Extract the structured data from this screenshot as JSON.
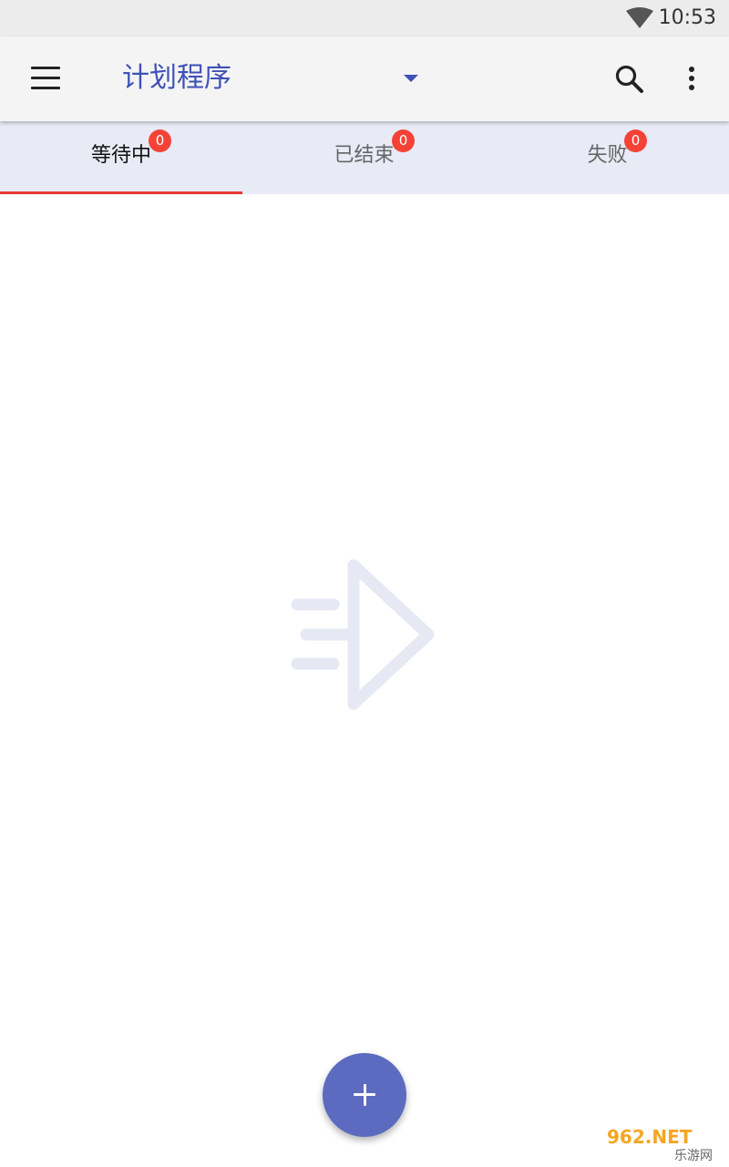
{
  "status_bar": {
    "time": "10:53",
    "icons": [
      "wifi-icon"
    ]
  },
  "app_bar": {
    "title": "计划程序",
    "icons": [
      "menu-icon",
      "dropdown-arrow-icon",
      "search-icon",
      "more-vert-icon"
    ]
  },
  "tabs": [
    {
      "label": "等待中",
      "badge": "0",
      "active": true
    },
    {
      "label": "已结束",
      "badge": "0",
      "active": false
    },
    {
      "label": "失败",
      "badge": "0",
      "active": false
    }
  ],
  "empty_state": {
    "icon": "send-arrow-icon"
  },
  "fab": {
    "icon": "plus-icon"
  },
  "watermark": {
    "text_top": "962.NET",
    "text_bottom": "乐游网"
  },
  "colors": {
    "primary": "#3f51b5",
    "fab": "#5c6bc0",
    "tab_background": "#e8eaf6",
    "badge": "#f44336",
    "indicator": "#e53935",
    "empty_icon": "#e6e8f4"
  }
}
